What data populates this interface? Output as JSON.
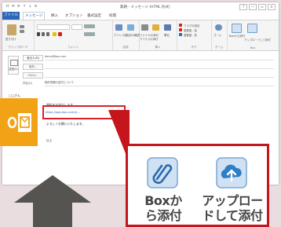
{
  "window": {
    "quick_access": "H ⟲ ⟳ ↑ ↓ ≡",
    "title": "無題 - メッセージ (HTML 形式)",
    "controls": [
      "?",
      "—",
      "▭",
      "✕"
    ]
  },
  "tabs": [
    "ファイル",
    "メッセージ",
    "挿入",
    "オプション",
    "書式設定",
    "校閲"
  ],
  "selected_tab": "メッセージ",
  "ribbon": {
    "groups": [
      {
        "label": "クリップボード",
        "buttons": [
          "貼り付け"
        ]
      },
      {
        "label": "フォント",
        "buttons": []
      },
      {
        "label": "名前",
        "buttons": [
          "アドレス帳",
          "名前の確認"
        ]
      },
      {
        "label": "挿入",
        "buttons": [
          "ファイルの添付",
          "アイテムの添付",
          "署名"
        ]
      },
      {
        "label": "タグ",
        "buttons": [
          "フラグの設定",
          "重要度 - 高",
          "重要度 - 低"
        ]
      },
      {
        "label": "ズーム",
        "buttons": [
          "ズーム"
        ]
      },
      {
        "label": "Box",
        "buttons": [
          "Boxから添付",
          "アップロードして添付"
        ]
      }
    ]
  },
  "compose": {
    "send_label": "送信(S)",
    "from_label": "差出人(M)",
    "from_value": "demo@box.com",
    "to_label": "宛先...",
    "cc_label": "CC(C)...",
    "subject_label": "件名(U)",
    "subject_value": "契約書類の送付について",
    "greeting": "□□さん",
    "body_line": "資料をお送りします。",
    "link_text": "https://app.box.com/s/...",
    "closing": "よろしくお願いいたします。",
    "signature": "以上"
  },
  "callout": {
    "buttons": [
      {
        "label_line1": "Boxか",
        "label_line2": "ら添付",
        "icon": "paperclip-icon"
      },
      {
        "label_line1": "アップロー",
        "label_line2": "ドして添付",
        "icon": "cloud-upload-icon"
      }
    ]
  },
  "colors": {
    "accent": "#2b67b8",
    "highlight": "#c4161c",
    "outlook_orange": "#f2a315",
    "arrow": "#555450",
    "background": "#e9dde0"
  }
}
